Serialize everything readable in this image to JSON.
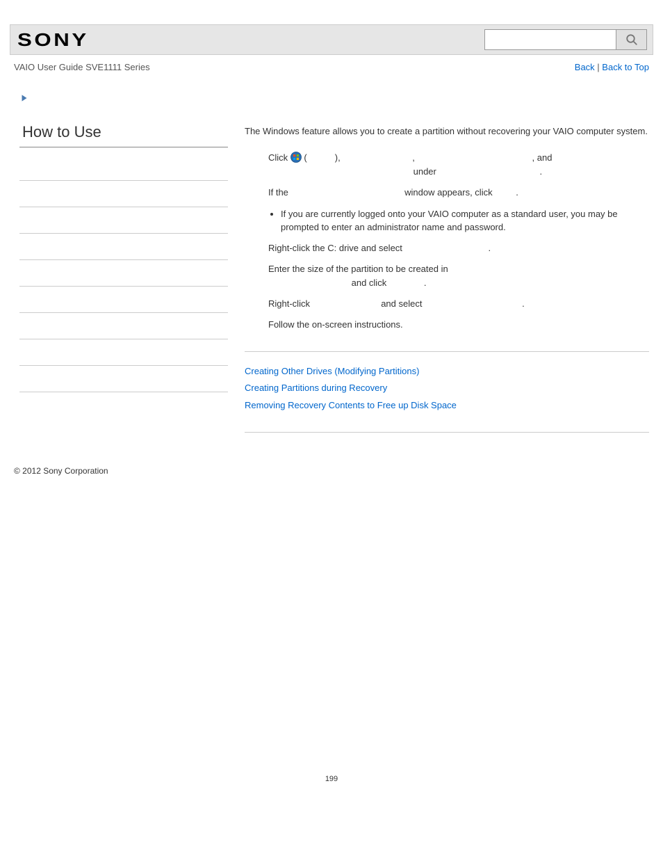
{
  "header": {
    "logo_text": "SONY",
    "search_placeholder": ""
  },
  "subheader": {
    "guide_title": "VAIO User Guide SVE1111 Series",
    "back_label": "Back",
    "divider": " | ",
    "top_label": "Back to Top"
  },
  "sidebar": {
    "heading": "How to Use",
    "items": [
      "",
      "",
      "",
      "",
      "",
      "",
      "",
      "",
      ""
    ]
  },
  "content": {
    "intro": "The Windows feature allows you to create a partition without recovering your VAIO computer system.",
    "step1_a": "Click ",
    "step1_b": " (",
    "step1_c": "), ",
    "step1_d": ", ",
    "step1_e": ", and ",
    "step1_f": " under ",
    "step1_g": ".",
    "step1_sub_a": "If the ",
    "step1_sub_b": " window appears, click ",
    "step1_sub_c": ".",
    "note1": "If you are currently logged onto your VAIO computer as a standard user, you may be prompted to enter an administrator name and password.",
    "step2_a": "Right-click the C: drive and select ",
    "step2_b": ".",
    "step3_a": "Enter the size of the partition to be created in ",
    "step3_b": " and click ",
    "step3_c": ".",
    "step4_a": "Right-click ",
    "step4_b": " and select ",
    "step4_c": ".",
    "step5": "Follow the on-screen instructions."
  },
  "related": {
    "links": [
      "Creating Other Drives (Modifying Partitions)",
      "Creating Partitions during Recovery",
      "Removing Recovery Contents to Free up Disk Space"
    ]
  },
  "footer": {
    "copyright": "© 2012 Sony Corporation",
    "page_number": "199"
  }
}
